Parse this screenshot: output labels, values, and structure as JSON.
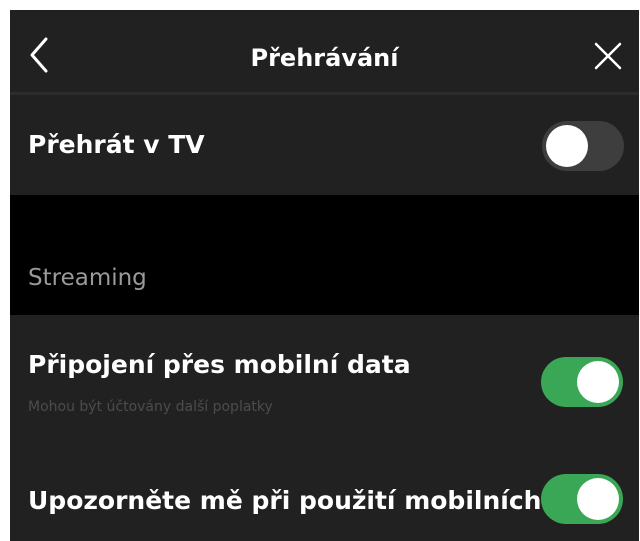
{
  "header": {
    "title": "Přehrávání",
    "back_icon": "chevron-left-icon",
    "close_icon": "close-icon"
  },
  "play_on_tv": {
    "label": "Přehrát v TV",
    "enabled": false
  },
  "streaming_section": {
    "label": "Streaming"
  },
  "mobile_data": {
    "label": "Připojení přes mobilní data",
    "sublabel": "Mohou být účtovány další poplatky",
    "enabled": true
  },
  "mobile_warning": {
    "label": "Upozorněte mě při použití mobilních...",
    "enabled": true
  },
  "colors": {
    "background": "#1a1a1a",
    "row": "#212121",
    "section_gap": "#000000",
    "toggle_on": "#3aa757",
    "toggle_off": "#3e3e3e",
    "text": "#ffffff",
    "section_label": "#9a9a9a"
  }
}
